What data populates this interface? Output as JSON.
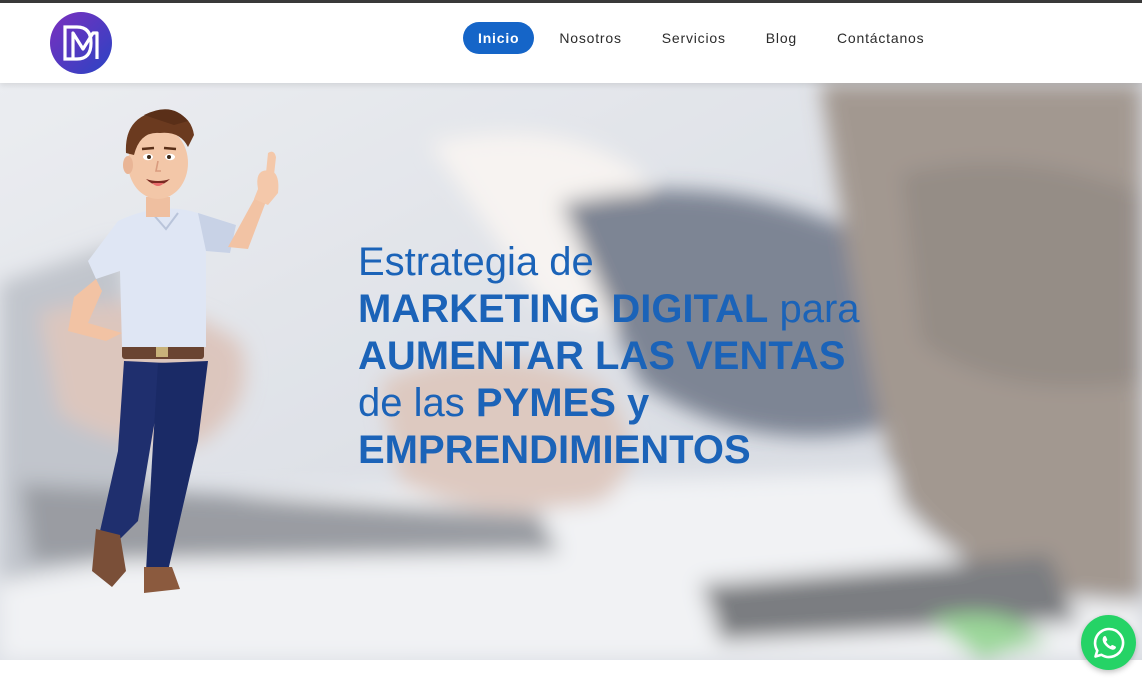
{
  "brand": {
    "logo_text": "DM",
    "logo_icon": "dm-monogram-logo"
  },
  "nav": {
    "items": [
      {
        "label": "Inicio",
        "active": true
      },
      {
        "label": "Nosotros",
        "active": false
      },
      {
        "label": "Servicios",
        "active": false
      },
      {
        "label": "Blog",
        "active": false
      },
      {
        "label": "Contáctanos",
        "active": false
      }
    ]
  },
  "hero": {
    "line1": "Estrategia de",
    "line2_bold": "MARKETING DIGITAL",
    "line2_light": " para",
    "line3": "AUMENTAR LAS VENTAS",
    "line4_light": "de las ",
    "line4_bold": "PYMES y",
    "line5": "EMPRENDIMIENTOS",
    "mascot_icon": "thumbs-up-man-illustration",
    "background_icon": "people-at-laptop-photo"
  },
  "whatsapp": {
    "icon": "whatsapp-icon"
  },
  "colors": {
    "accent": "#1565c8",
    "headline": "#1b63b8",
    "whatsapp": "#25d366",
    "top_stripe": "#3a3a3a"
  }
}
